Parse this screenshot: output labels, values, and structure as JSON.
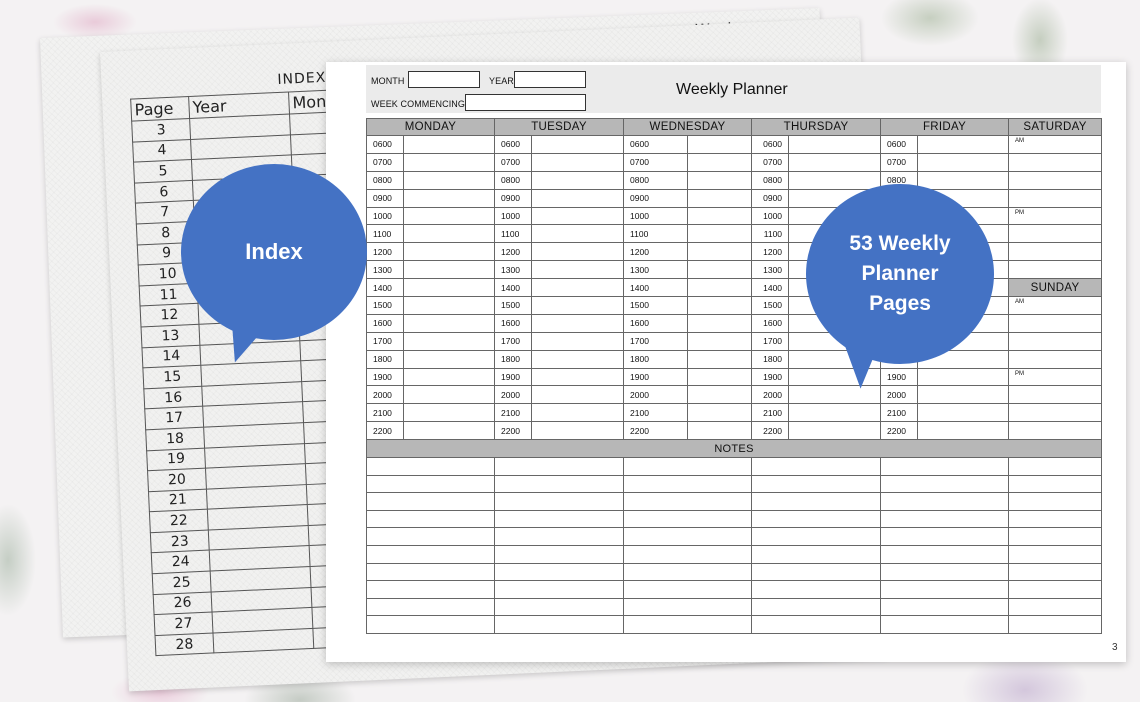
{
  "index_page": {
    "title": "INDEX",
    "columns": [
      "Page",
      "Year",
      "Mont"
    ],
    "pages": [
      "3",
      "4",
      "5",
      "6",
      "7",
      "8",
      "9",
      "10",
      "11",
      "12",
      "13",
      "14",
      "15",
      "16",
      "17",
      "18",
      "19",
      "20",
      "21",
      "22",
      "23",
      "24",
      "25",
      "26",
      "27",
      "28"
    ]
  },
  "back_page": {
    "label": "Week"
  },
  "planner": {
    "title": "Weekly Planner",
    "month_label": "MONTH",
    "year_label": "YEAR",
    "week_commencing_label": "WEEK COMMENCING",
    "days": [
      "MONDAY",
      "TUESDAY",
      "WEDNESDAY",
      "THURSDAY",
      "FRIDAY",
      "SATURDAY"
    ],
    "sunday": "SUNDAY",
    "am": "AM",
    "pm": "PM",
    "times": [
      "0600",
      "0700",
      "0800",
      "0900",
      "1000",
      "1100",
      "1200",
      "1300",
      "1400",
      "1500",
      "1600",
      "1700",
      "1800",
      "1900",
      "2000",
      "2100",
      "2200"
    ],
    "friday_times": [
      "0600",
      "0700",
      "0800",
      "1900",
      "2000",
      "2100",
      "2200"
    ],
    "notes_label": "NOTES",
    "page_number": "3"
  },
  "callouts": {
    "index": "Index",
    "weekly": [
      "53 Weekly",
      "Planner",
      "Pages"
    ]
  },
  "colors": {
    "callout": "#4472c4",
    "day_header": "#b7b7b7",
    "header_bar": "#ebebeb"
  }
}
